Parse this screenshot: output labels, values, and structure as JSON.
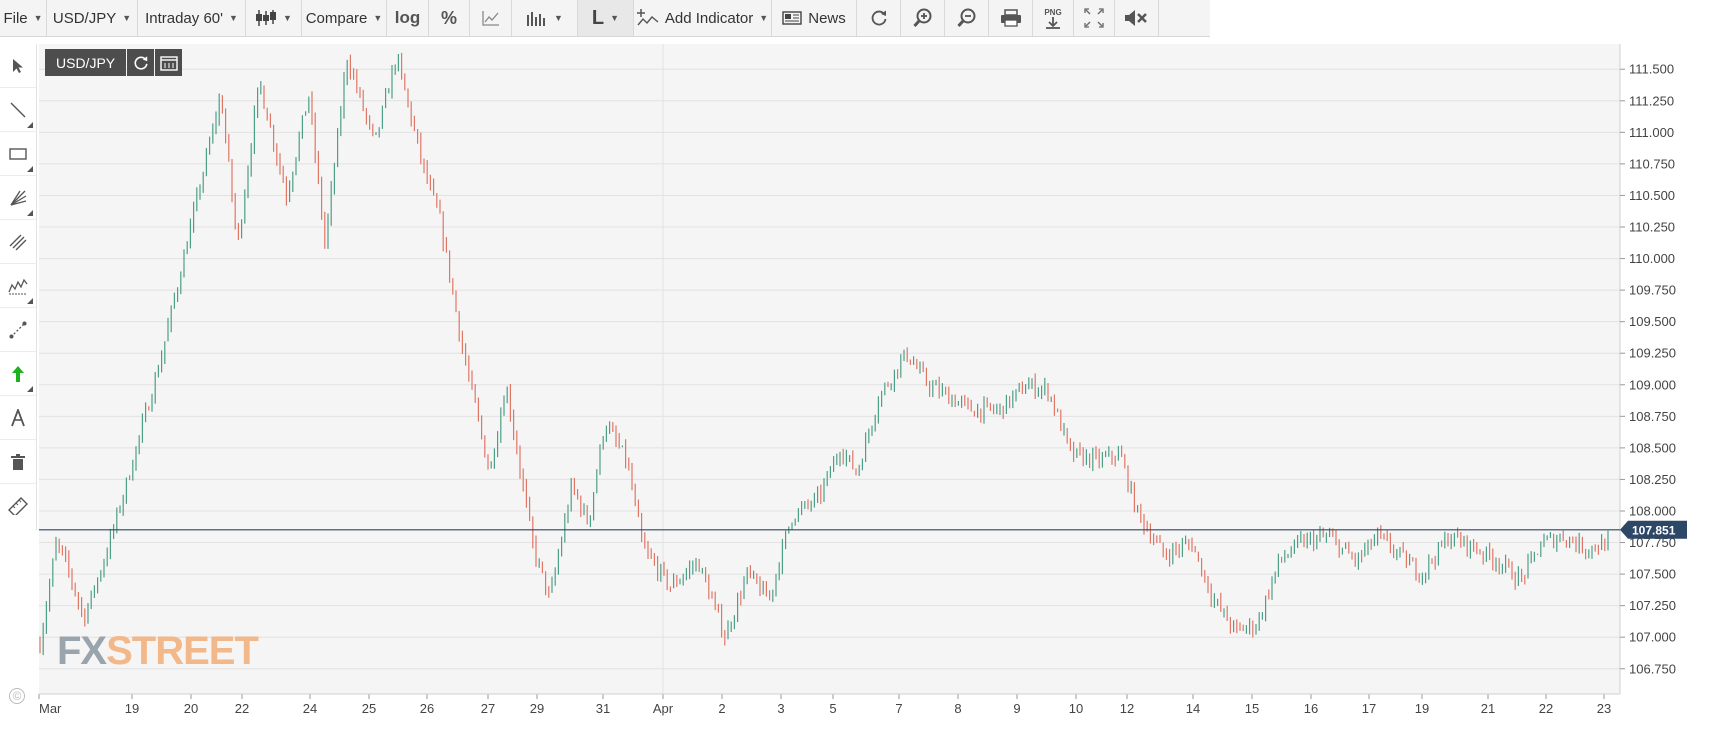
{
  "toolbar": {
    "file_label": "File",
    "symbol_label": "USD/JPY",
    "interval_label": "Intraday 60'",
    "chart_type_icon": "candlestick-icon",
    "compare_label": "Compare",
    "log_label": "log",
    "percent_label": "%",
    "draw_icon": "area-chart-icon",
    "volume_icon": "volume-bars-icon",
    "layout_label": "L",
    "add_indicator_label": "Add Indicator",
    "news_label": "News",
    "refresh_icon": "refresh-icon",
    "zoom_in_icon": "zoom-in-icon",
    "zoom_out_icon": "zoom-out-icon",
    "print_icon": "print-icon",
    "png_label": "PNG",
    "fullscreen_icon": "fullscreen-icon",
    "mute_icon": "mute-icon"
  },
  "left_tools": [
    "cursor-icon",
    "line-icon",
    "rectangle-icon",
    "fan-icon",
    "channel-icon",
    "pattern-icon",
    "measure-icon",
    "arrow-up-icon",
    "text-icon",
    "trash-icon",
    "ruler-icon"
  ],
  "symbol_box": {
    "label": "USD/JPY",
    "refresh_icon": "refresh-icon",
    "candles_icon": "calendar-icon"
  },
  "watermark": {
    "part1": "FX",
    "part2": "STREET"
  },
  "copyright": "©",
  "colors": {
    "up": "#4e9f87",
    "down": "#e07766",
    "price_line": "#2d4766",
    "price_tag_bg": "#2d4766",
    "grid": "#e2e2e2",
    "plot_bg": "#f5f5f5"
  },
  "chart_data": {
    "type": "ohlc",
    "symbol": "USD/JPY",
    "interval": "Intraday 60'",
    "last_price": 107.851,
    "last_price_label": "107.851",
    "ylim": [
      106.55,
      111.7
    ],
    "y_ticks": [
      "111.500",
      "111.250",
      "111.000",
      "110.750",
      "110.500",
      "110.250",
      "110.000",
      "109.750",
      "109.500",
      "109.250",
      "109.000",
      "108.750",
      "108.500",
      "108.250",
      "108.000",
      "107.750",
      "107.500",
      "107.250",
      "107.000",
      "106.750"
    ],
    "x_ticks": [
      "Mar",
      "19",
      "20",
      "22",
      "24",
      "25",
      "26",
      "27",
      "29",
      "31",
      "Apr",
      "2",
      "3",
      "5",
      "7",
      "8",
      "9",
      "10",
      "12",
      "14",
      "15",
      "16",
      "17",
      "19",
      "21",
      "22",
      "23"
    ],
    "grid": true,
    "up_color": "#4e9f87",
    "down_color": "#e07766",
    "price_path": [
      [
        0,
        106.95
      ],
      [
        0.03,
        107.75
      ],
      [
        0.05,
        107.55
      ],
      [
        0.08,
        107.15
      ],
      [
        0.12,
        107.65
      ],
      [
        0.16,
        108.25
      ],
      [
        0.22,
        109.2
      ],
      [
        0.28,
        110.35
      ],
      [
        0.33,
        111.3
      ],
      [
        0.36,
        110.1
      ],
      [
        0.4,
        111.4
      ],
      [
        0.45,
        110.5
      ],
      [
        0.49,
        111.3
      ],
      [
        0.52,
        110.1
      ],
      [
        0.56,
        111.6
      ],
      [
        0.61,
        110.9
      ],
      [
        0.65,
        111.6
      ],
      [
        0.7,
        110.7
      ],
      [
        0.73,
        110.3
      ],
      [
        0.77,
        109.3
      ],
      [
        0.82,
        108.3
      ],
      [
        0.85,
        109.0
      ],
      [
        0.9,
        107.7
      ],
      [
        0.93,
        107.3
      ],
      [
        0.97,
        108.2
      ],
      [
        1.0,
        107.9
      ],
      [
        1.03,
        108.7
      ],
      [
        1.07,
        108.4
      ],
      [
        1.1,
        107.7
      ],
      [
        1.15,
        107.4
      ],
      [
        1.2,
        107.6
      ],
      [
        1.25,
        107.0
      ],
      [
        1.29,
        107.5
      ],
      [
        1.33,
        107.3
      ],
      [
        1.37,
        107.95
      ],
      [
        1.42,
        108.1
      ],
      [
        1.46,
        108.5
      ],
      [
        1.49,
        108.3
      ],
      [
        1.53,
        108.9
      ],
      [
        1.58,
        109.25
      ],
      [
        1.62,
        109.0
      ],
      [
        1.66,
        108.9
      ],
      [
        1.7,
        108.8
      ],
      [
        1.75,
        108.8
      ],
      [
        1.8,
        109.0
      ],
      [
        1.84,
        108.95
      ],
      [
        1.88,
        108.45
      ],
      [
        1.93,
        108.4
      ],
      [
        1.97,
        108.45
      ],
      [
        2.0,
        108.0
      ],
      [
        2.05,
        107.65
      ],
      [
        2.1,
        107.75
      ],
      [
        2.14,
        107.3
      ],
      [
        2.18,
        107.05
      ],
      [
        2.22,
        107.1
      ],
      [
        2.26,
        107.6
      ],
      [
        2.3,
        107.75
      ],
      [
        2.35,
        107.8
      ],
      [
        2.4,
        107.6
      ],
      [
        2.44,
        107.8
      ],
      [
        2.48,
        107.65
      ],
      [
        2.52,
        107.5
      ],
      [
        2.57,
        107.8
      ],
      [
        2.62,
        107.7
      ],
      [
        2.66,
        107.6
      ],
      [
        2.7,
        107.45
      ],
      [
        2.74,
        107.75
      ],
      [
        2.78,
        107.8
      ],
      [
        2.82,
        107.7
      ],
      [
        2.86,
        107.75
      ]
    ]
  }
}
